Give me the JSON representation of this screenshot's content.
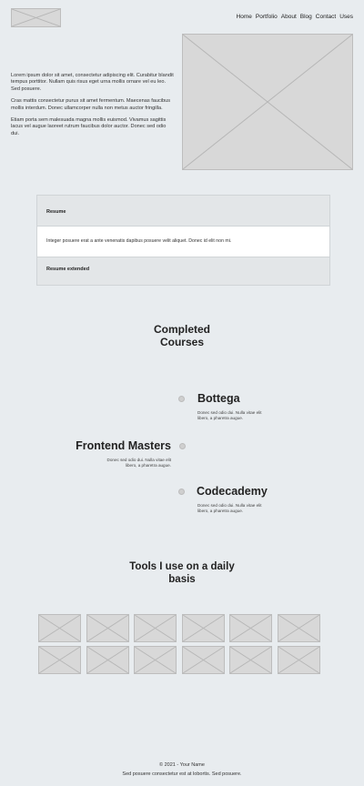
{
  "header": {
    "logo_icon": "logo-placeholder-image",
    "nav": [
      "Home",
      "Portfolio",
      "About",
      "Blog",
      "Contact",
      "Uses"
    ]
  },
  "intro": {
    "paragraphs": [
      "Lorem ipsum dolor sit amet, consectetur adipiscing elit. Curabitur blandit tempus porttitor. Nullam quis risus eget urna mollis ornare vel eu leo. Sed posuere.",
      "Cras mattis consectetur purus sit amet fermentum. Maecenas faucibus mollis interdum. Donec ullamcorper nulla non metus auctor fringilla.",
      "Etiam porta sem malesuada magna mollis euismod. Vivamus sagittis lacus vel augue laoreet rutrum faucibus dolor auctor. Donec sed odio dui."
    ]
  },
  "hero_icon": "hero-placeholder-image",
  "resume": {
    "header": "Resume",
    "body": "Integer posuere erat a ante venenatis dapibus posuere velit aliquet. Donec id elit non mi.",
    "footer": "Resume extended"
  },
  "courses": {
    "title_lines": [
      "Completed",
      "Courses"
    ],
    "items": [
      {
        "title": "Bottega",
        "desc": "Donec sed odio dui. Nulla vitae elit libero, a pharetra augue."
      },
      {
        "title": "Frontend Masters",
        "desc": "Donec sed odio dui. Nulla vitae elit libero, a pharetra augue."
      },
      {
        "title": "Codecademy",
        "desc": "Donec sed odio dui. Nulla vitae elit libero, a pharetra augue."
      }
    ]
  },
  "tools": {
    "title_lines": [
      "Tools I use on a daily",
      "basis"
    ],
    "icons": [
      "tool-1",
      "tool-2",
      "tool-3",
      "tool-4",
      "tool-5",
      "tool-6",
      "tool-7",
      "tool-8",
      "tool-9",
      "tool-10",
      "tool-11",
      "tool-12"
    ]
  },
  "footer": {
    "line1": "© 2021 - Your Name",
    "line2": "Sed posuere consectetur est at lobortis. Sed posuere."
  }
}
